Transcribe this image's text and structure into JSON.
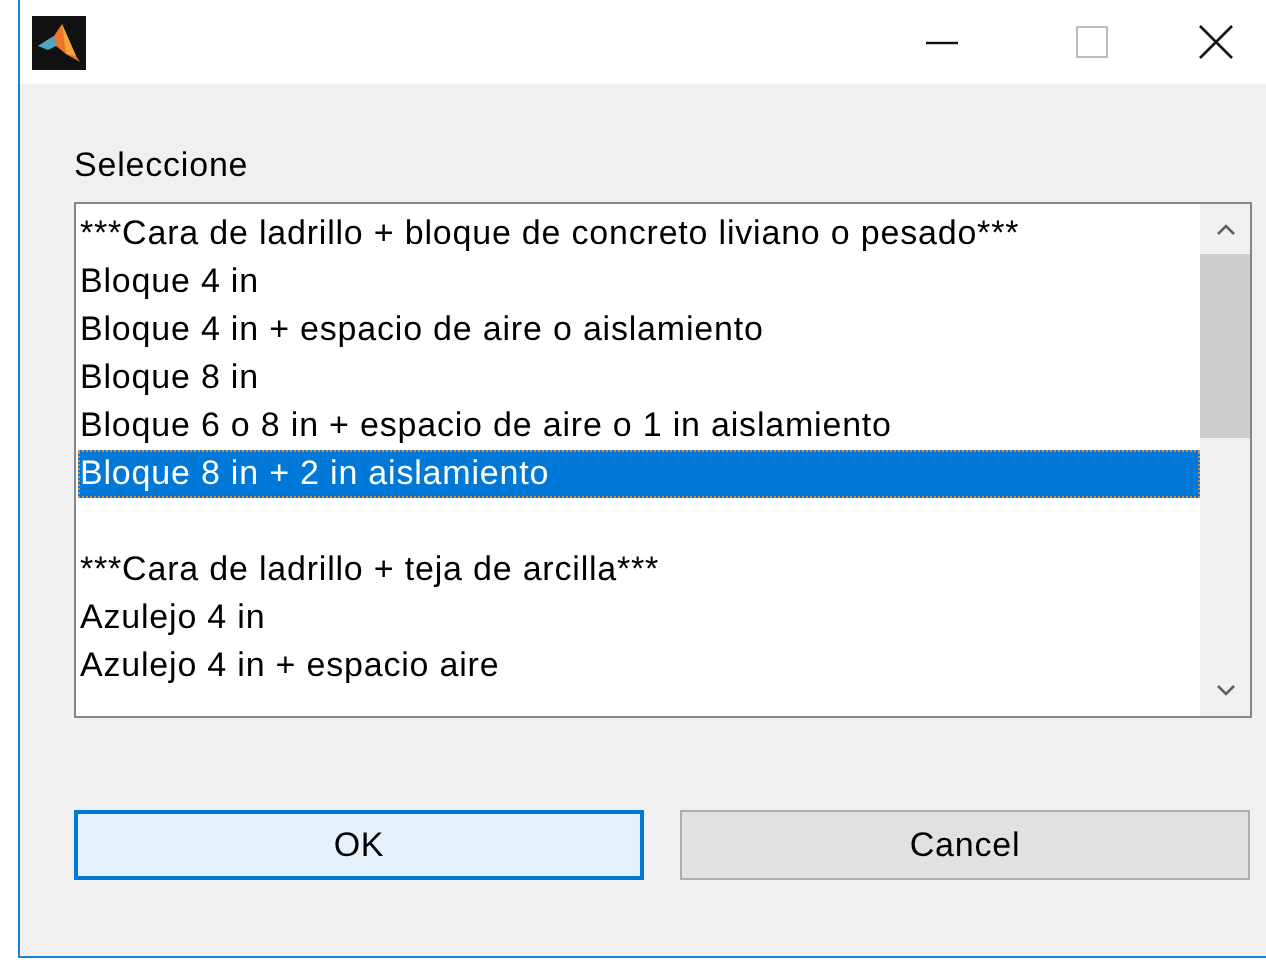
{
  "prompt": "Seleccione",
  "list": {
    "items": [
      {
        "kind": "option",
        "label": "***Cara de ladrillo + bloque de concreto liviano o pesado***",
        "selected": false
      },
      {
        "kind": "option",
        "label": "Bloque 4 in",
        "selected": false
      },
      {
        "kind": "option",
        "label": "Bloque 4 in + espacio de aire o aislamiento",
        "selected": false
      },
      {
        "kind": "option",
        "label": "Bloque 8 in",
        "selected": false
      },
      {
        "kind": "option",
        "label": "Bloque 6 o 8 in + espacio de aire o 1 in aislamiento",
        "selected": false
      },
      {
        "kind": "option",
        "label": "Bloque 8 in + 2 in aislamiento",
        "selected": true
      },
      {
        "kind": "blank",
        "selected": false
      },
      {
        "kind": "option",
        "label": "***Cara de ladrillo + teja de arcilla***",
        "selected": false
      },
      {
        "kind": "option",
        "label": "Azulejo 4 in",
        "selected": false
      },
      {
        "kind": "option",
        "label": "Azulejo 4 in + espacio aire",
        "selected": false
      }
    ]
  },
  "buttons": [
    {
      "label": "OK",
      "default": true
    },
    {
      "label": "Cancel",
      "default": false
    }
  ]
}
